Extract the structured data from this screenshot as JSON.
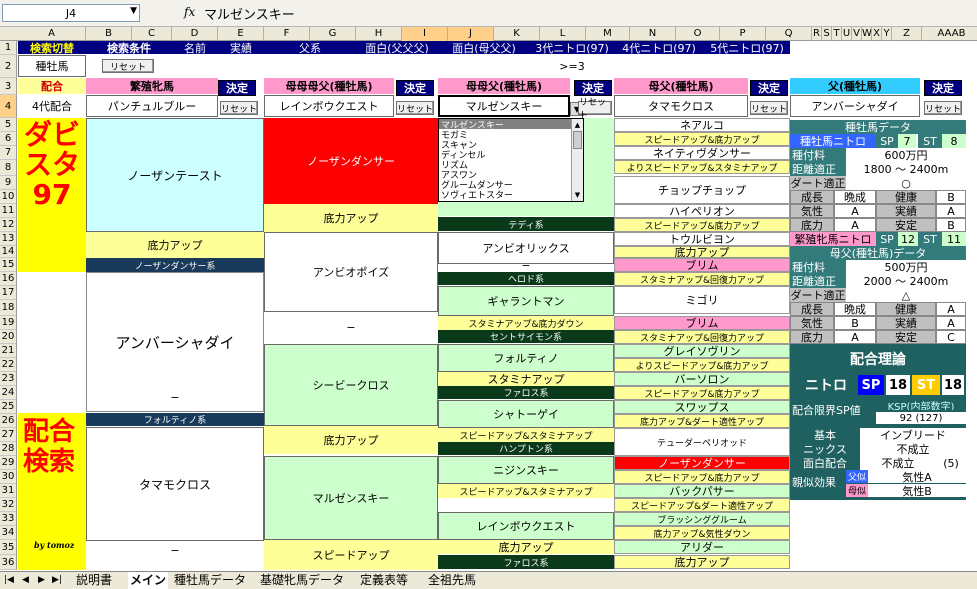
{
  "namebox": "J4",
  "fx": "fx",
  "formula_value": "マルゼンスキー",
  "columns": [
    "A",
    "B",
    "C",
    "D",
    "E",
    "F",
    "G",
    "H",
    "I",
    "J",
    "K",
    "L",
    "M",
    "N",
    "O",
    "P",
    "Q",
    "R",
    "S",
    "T",
    "U",
    "V",
    "W",
    "X",
    "Y",
    "Z",
    "AAAB",
    "AAAAAAAAAA"
  ],
  "rows": [
    "1",
    "2",
    "3",
    "4",
    "5",
    "6",
    "7",
    "8",
    "9",
    "10",
    "11",
    "12",
    "13",
    "14",
    "15",
    "16",
    "17",
    "18",
    "19",
    "20",
    "21",
    "22",
    "23",
    "24",
    "25",
    "26",
    "27",
    "28",
    "29",
    "30",
    "31",
    "32",
    "33",
    "34",
    "35",
    "36"
  ],
  "r1": {
    "search_switch": "検索切替",
    "search_cond": "検索条件",
    "name": "名前",
    "record": "実績",
    "father": "父系",
    "omoshiro_ff": "面白(父父父)",
    "omoshiro_mf": "面白(母父父)",
    "nitro3": "3代ニトロ(97)",
    "nitro4": "4代ニトロ(97)",
    "nitro5": "5代ニトロ(97)"
  },
  "r2": {
    "mode": "種牡馬",
    "reset": "リセット",
    "cond": ">=3"
  },
  "r3": {
    "haigo": "配合",
    "h1": "繁殖牝馬",
    "h2": "母母母父(種牡馬)",
    "h3": "母母父(種牡馬)",
    "h4": "母父(種牡馬)",
    "h5": "父(種牡馬)",
    "decide": "決定",
    "reset": "リセット"
  },
  "r4": {
    "gen": "4代配合",
    "v1": "パンチュルブルー",
    "v2": "レインボウクエスト",
    "v3": "マルゼンスキー",
    "v4": "タマモクロス",
    "v5": "アンバーシャダイ"
  },
  "dropdown": [
    "マルゼンスキー",
    "モガミ",
    "スキャン",
    "ディンセル",
    "リズム",
    "アスワン",
    "グルームダンサー",
    "ソヴィエトスター"
  ],
  "logo1": "ダビスタ97",
  "logo2": "配合検索",
  "logo_by": "by tomoz",
  "colB": {
    "b1": "ノーザンテースト",
    "b1a": "底力アップ",
    "b1b": "ノーザンダンサー系",
    "b2": "アンバーシャダイ",
    "b2a": "−",
    "b3": "フォルティノ系",
    "b4": "タマモクロス",
    "b4a": "−"
  },
  "colF": {
    "f1": "ノーザンダンサー",
    "f1a": "底力アップ",
    "f2": "アンビオポイズ",
    "f2a": "−",
    "f3": "シービークロス",
    "f3a": "底力アップ",
    "f4": "マルゼンスキー",
    "f4a": "スピードアップ"
  },
  "colJ": {
    "j1a": "テディ系",
    "j2": "アンビオリックス",
    "j2a": "−",
    "j2b": "ヘロド系",
    "j3": "ギャラントマン",
    "j3a": "スタミナアップ&底力ダウン",
    "j3b": "セントサイモン系",
    "j4": "フォルティノ",
    "j4a": "スタミナアップ",
    "j4b": "ファロス系",
    "j5": "シャトーゲイ",
    "j5a": "スピードアップ&スタミナアップ",
    "j5b": "ハンプトン系",
    "j6": "ニジンスキー",
    "j6a": "スピードアップ&スタミナアップ",
    "j7": "レインボウクエスト",
    "j7a": "底力アップ",
    "j7b": "ファロス系"
  },
  "colN": [
    "ネアルコ",
    "スピードアップ&底力アップ",
    "ネイティヴダンサー",
    "よりスピードアップ&スタミナアップ",
    "チョップチョップ",
    "ハイペリオン",
    "スピードアップ&底力アップ",
    "トウルビヨン",
    "底力アップ",
    "ブリム",
    "スタミナアップ&回復力アップ",
    "ミゴリ",
    "ブリム",
    "スタミナアップ&回復力アップ",
    "グレイソヴリン",
    "よりスピードアップ&底力アップ",
    "バーソロン",
    "スピードアップ&底力アップ",
    "スワップス",
    "底力アップ&ダート適性アップ",
    "テューダーペリオッド",
    "ノーザンダンサー",
    "スピードアップ&底力アップ",
    "バックパサー",
    "スピードアップ&ダート適性アップ",
    "ブラッシンググルーム",
    "底力アップ&気性ダウン",
    "アリダー",
    "底力アップ"
  ],
  "panel1": {
    "title": "種牡馬データ",
    "nitro": "種牡馬ニトロ",
    "sp": "SP",
    "sp_v": "7",
    "st": "ST",
    "st_v": "8",
    "fee_l": "種付料",
    "fee": "600万円",
    "dist_l": "距離適正",
    "dist": "1800 〜 2400m",
    "dirt_l": "ダート適正",
    "dirt": "○",
    "r1": [
      "成長",
      "晩成",
      "健康",
      "B"
    ],
    "r2": [
      "気性",
      "A",
      "実績",
      "A"
    ],
    "r3": [
      "底力",
      "A",
      "安定",
      "B"
    ]
  },
  "panel2": {
    "nitro": "繁殖牝馬ニトロ",
    "sp": "SP",
    "sp_v": "12",
    "st": "ST",
    "st_v": "11",
    "title": "母父(種牡馬)データ",
    "fee_l": "種付料",
    "fee": "500万円",
    "dist_l": "距離適正",
    "dist": "2000 〜 2400m",
    "dirt_l": "ダート適正",
    "dirt": "△",
    "r1": [
      "成長",
      "晩成",
      "健康",
      "A"
    ],
    "r2": [
      "気性",
      "B",
      "実績",
      "A"
    ],
    "r3": [
      "底力",
      "A",
      "安定",
      "C"
    ]
  },
  "theory": {
    "title": "配合理論",
    "nitro": "ニトロ",
    "sp": "SP",
    "sp_v": "18",
    "st": "ST",
    "st_v": "18",
    "limit_l": "配合限界SP値",
    "ksp": "KSP(内部数字)",
    "ksp_v": "92 (127)",
    "basic_l": "基本",
    "basic": "インブリード",
    "nick_l": "ニックス",
    "nick": "不成立",
    "omo_l": "面白配合",
    "omo": "不成立",
    "omo_v": "(5)",
    "eff_l": "親似効果",
    "father": "父似",
    "father_v": "気性A",
    "mother": "母似",
    "mother_v": "気性B"
  },
  "tabs": [
    "説明書",
    "メイン",
    "種牡馬データ",
    "基礎牝馬データ",
    "定義表等",
    "全祖先馬"
  ],
  "nav": [
    "|◀",
    "◀",
    "▶",
    "▶|"
  ]
}
